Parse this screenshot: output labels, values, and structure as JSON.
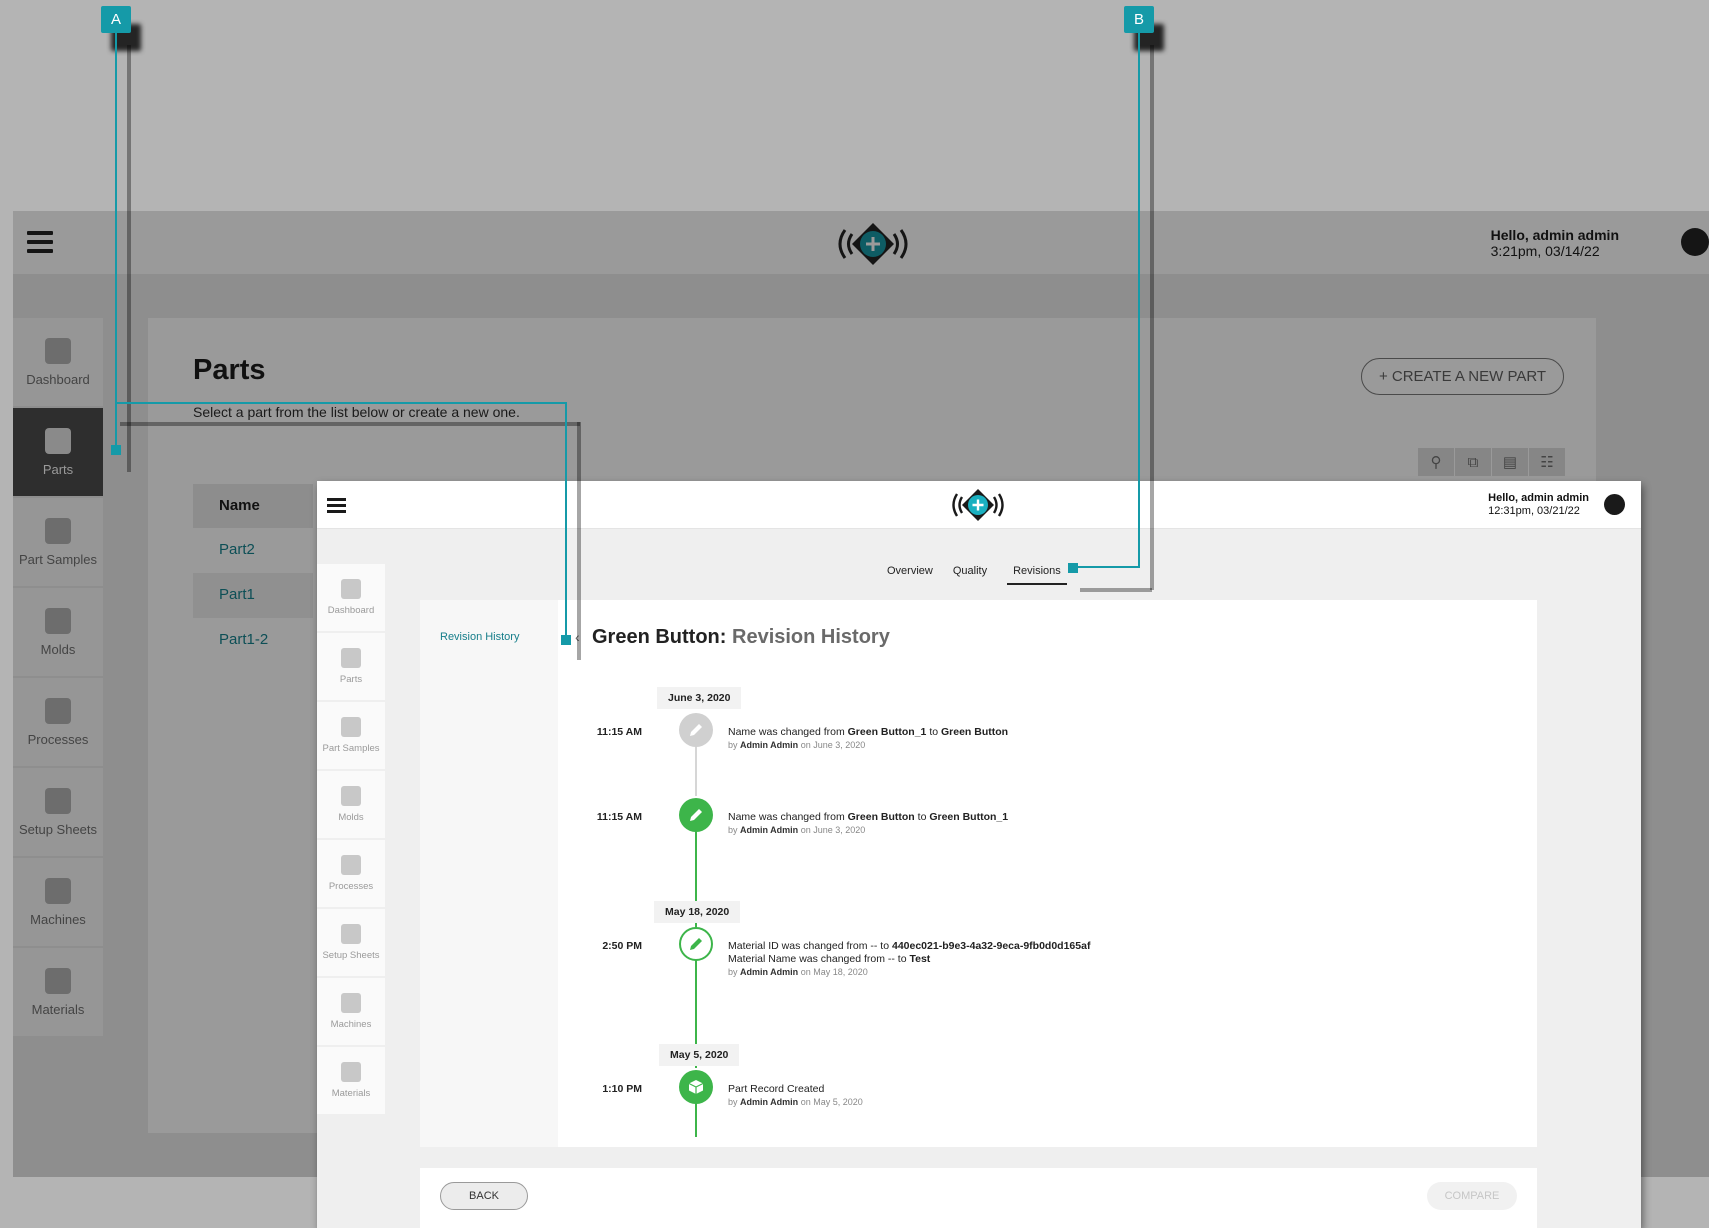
{
  "callouts": {
    "a": "A",
    "b": "B"
  },
  "background_app": {
    "greeting": "Hello, admin admin",
    "datetime": "3:21pm, 03/14/22",
    "nav": [
      "Dashboard",
      "Parts",
      "Part Samples",
      "Molds",
      "Processes",
      "Setup Sheets",
      "Machines",
      "Materials"
    ],
    "page_title": "Parts",
    "subtitle": "Select a part from the list below or create a new one.",
    "create_button": "+ CREATE A NEW PART",
    "table_header": "Name",
    "rows": [
      "Part2",
      "Part1",
      "Part1-2"
    ]
  },
  "window": {
    "greeting": "Hello, admin admin",
    "datetime": "12:31pm, 03/21/22",
    "nav": [
      "Dashboard",
      "Parts",
      "Part Samples",
      "Molds",
      "Processes",
      "Setup Sheets",
      "Machines",
      "Materials"
    ],
    "tabs": [
      "Overview",
      "Quality",
      "Revisions"
    ],
    "side_label": "Revision History",
    "title_main": "Green Button: ",
    "title_sub": "Revision History",
    "dates": [
      "June 3, 2020",
      "May 18, 2020",
      "May 5, 2020"
    ],
    "entries": [
      {
        "time": "11:15 AM",
        "line1_pre": "Name was changed from ",
        "line1_b1": "Green Button_1",
        "line1_mid": " to ",
        "line1_b2": "Green Button",
        "by_name": "Admin Admin",
        "on": " on June 3, 2020"
      },
      {
        "time": "11:15 AM",
        "line1_pre": "Name was changed from ",
        "line1_b1": "Green Button",
        "line1_mid": " to ",
        "line1_b2": "Green Button_1",
        "by_name": "Admin Admin",
        "on": " on June 3, 2020"
      },
      {
        "time": "2:50 PM",
        "line1_pre": "Material ID was changed from -- to ",
        "line1_b1": "440ec021-b9e3-4a32-9eca-9fb0d0d165af",
        "line2_pre": "Material Name was changed from -- to ",
        "line2_b1": "Test",
        "by_name": "Admin Admin",
        "on": " on May 18, 2020"
      },
      {
        "time": "1:10 PM",
        "line1_pre": "Part Record Created",
        "by_name": "Admin Admin",
        "on": " on May 5, 2020"
      }
    ],
    "by_prefix": "by ",
    "back_button": "BACK",
    "compare_button": "COMPARE"
  },
  "colors": {
    "teal": "#159aa8",
    "green": "#3db54a",
    "link": "#167e8a"
  },
  "icons": [
    "hamburger-icon",
    "logo-icon",
    "user-icon",
    "search-icon",
    "copy-icon",
    "archive-icon",
    "columns-icon",
    "pencil-icon",
    "box-icon",
    "back-arrow-icon"
  ]
}
